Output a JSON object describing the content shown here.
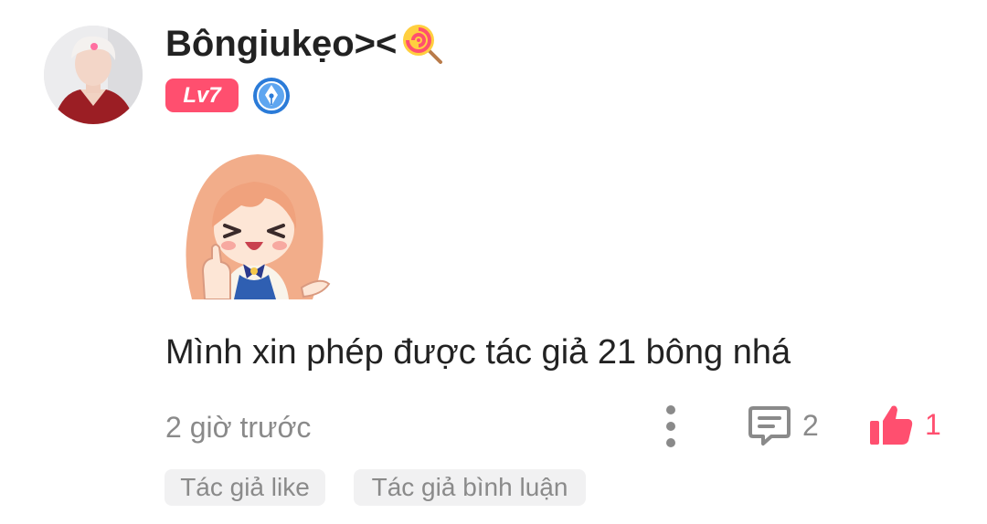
{
  "comment": {
    "user": {
      "name": "Bôngiukẹo><",
      "name_emoji": "lollipop-icon",
      "level": "Lv7",
      "badge_icon": "pen-badge-icon",
      "avatar": "user-avatar-photo"
    },
    "sticker": "anime-girl-thumbs-up-sticker",
    "text": "Mình xin phép được tác giả 21 bông nhá",
    "time": "2 giờ trước",
    "reply_count": "2",
    "like_count": "1",
    "tags": [
      "Tác giả like",
      "Tác giả bình luận"
    ]
  },
  "colors": {
    "accent": "#ff4f6f",
    "muted_text": "#8a8a8a",
    "tag_bg": "#f1f1f2",
    "badge_blue": "#2b7bd8"
  }
}
